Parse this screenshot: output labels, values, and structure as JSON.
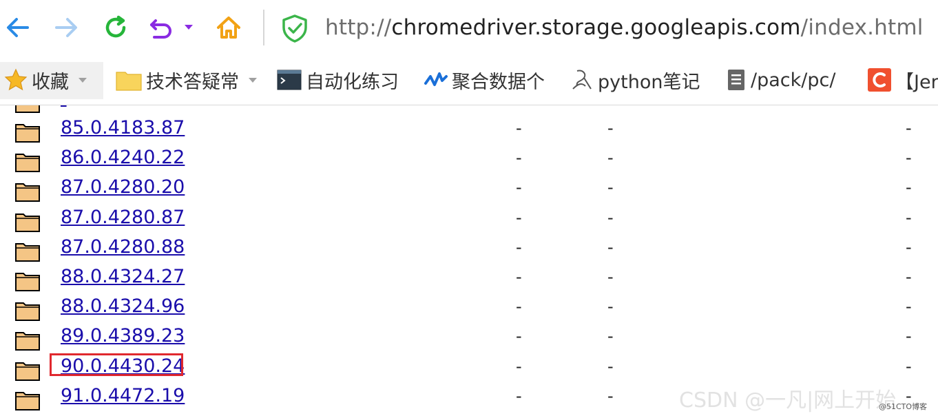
{
  "browser": {
    "url_scheme": "http://",
    "url_host": "chromedriver.storage.googleapis.com",
    "url_path": "/index.html"
  },
  "bookmarks": [
    {
      "label": "收藏",
      "icon": "star-icon"
    },
    {
      "label": "技术答疑常",
      "icon": "folder-icon"
    },
    {
      "label": "自动化练习",
      "icon": "terminal-icon"
    },
    {
      "label": "聚合数据个",
      "icon": "zigzag-logo-icon"
    },
    {
      "label": "python笔记",
      "icon": "pen-logo-icon"
    },
    {
      "label": "/pack/pc/",
      "icon": "document-icon"
    },
    {
      "label": "【Jer",
      "icon": "csdn-c-icon"
    }
  ],
  "listing": {
    "rows": [
      {
        "name": "85.0.4183.87",
        "col1": "-",
        "col2": "-",
        "col3": "-"
      },
      {
        "name": "86.0.4240.22",
        "col1": "-",
        "col2": "-",
        "col3": "-"
      },
      {
        "name": "87.0.4280.20",
        "col1": "-",
        "col2": "-",
        "col3": "-"
      },
      {
        "name": "87.0.4280.87",
        "col1": "-",
        "col2": "-",
        "col3": "-"
      },
      {
        "name": "87.0.4280.88",
        "col1": "-",
        "col2": "-",
        "col3": "-"
      },
      {
        "name": "88.0.4324.27",
        "col1": "-",
        "col2": "-",
        "col3": "-"
      },
      {
        "name": "88.0.4324.96",
        "col1": "-",
        "col2": "-",
        "col3": "-"
      },
      {
        "name": "89.0.4389.23",
        "col1": "-",
        "col2": "-",
        "col3": "-"
      },
      {
        "name": "90.0.4430.24",
        "col1": "-",
        "col2": "-",
        "col3": "-"
      },
      {
        "name": "91.0.4472.19",
        "col1": "-",
        "col2": "-",
        "col3": "-"
      }
    ],
    "highlighted": "90.0.4430.24"
  },
  "watermark": {
    "main": "CSDN @一凡|网上开始",
    "corner": "@51CTO博客"
  },
  "colors": {
    "link": "#1a0dab",
    "highlight": "#e0282e",
    "back_arrow": "#2a8be6",
    "refresh": "#26b53a",
    "undo": "#8a2be2",
    "home": "#f2a215"
  }
}
